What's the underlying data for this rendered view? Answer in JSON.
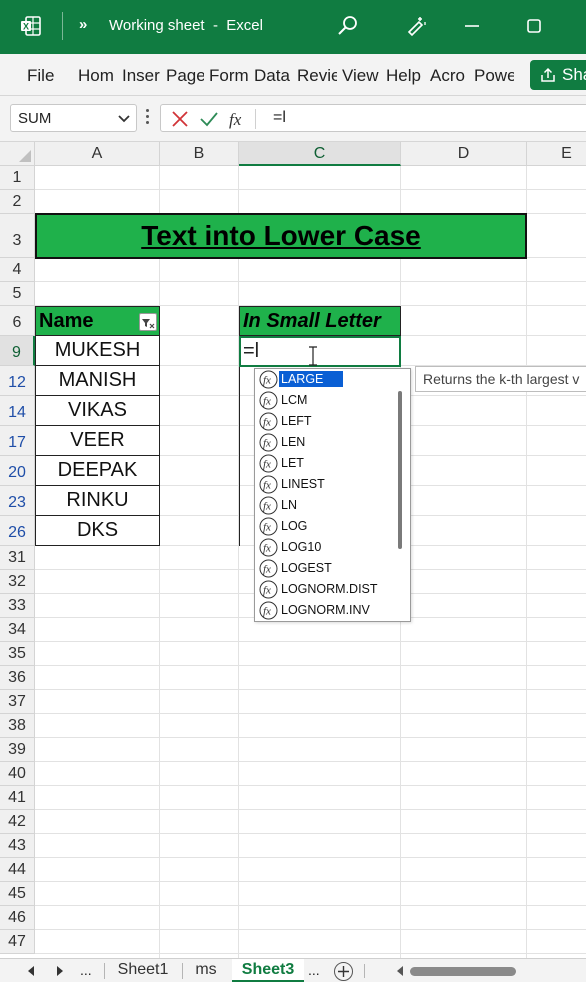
{
  "window": {
    "more": "»",
    "title": "Working sheet  -  Excel"
  },
  "menu": {
    "items": [
      "File",
      "Hom",
      "Inser",
      "Page",
      "Form",
      "Data",
      "Revie",
      "View",
      "Help",
      "Acro",
      "Powe"
    ],
    "share_label": "Sha"
  },
  "formula_bar": {
    "name_box": "SUM",
    "formula": "=l"
  },
  "columns": [
    "A",
    "B",
    "C",
    "D",
    "E"
  ],
  "rows": [
    "1",
    "2",
    "3",
    "4",
    "5",
    "6",
    "9",
    "12",
    "14",
    "17",
    "20",
    "23",
    "26",
    "31",
    "32",
    "33",
    "34",
    "35",
    "36",
    "37",
    "38",
    "39",
    "40",
    "41",
    "42",
    "43",
    "44",
    "45",
    "46",
    "47"
  ],
  "sheet": {
    "banner": "Text into Lower Case",
    "header_a": "Name",
    "header_c": "In Small Letter",
    "names": [
      "MUKESH",
      "MANISH",
      "VIKAS",
      "VEER",
      "DEEPAK",
      "RINKU",
      "DKS"
    ],
    "active_cell_text": "=l"
  },
  "autocomplete": {
    "items": [
      "LARGE",
      "LCM",
      "LEFT",
      "LEN",
      "LET",
      "LINEST",
      "LN",
      "LOG",
      "LOG10",
      "LOGEST",
      "LOGNORM.DIST",
      "LOGNORM.INV"
    ],
    "selected_index": 0,
    "tooltip": "Returns the k-th largest v"
  },
  "tabs": {
    "ellipsis_left": "...",
    "sheets": [
      "Sheet1",
      "ms",
      "Sheet3"
    ],
    "active": "Sheet3",
    "ellipsis_right": "..."
  },
  "colors": {
    "excel_green": "#107c41",
    "banner_green": "#1fb14b",
    "selection_blue": "#0a5fd4"
  }
}
